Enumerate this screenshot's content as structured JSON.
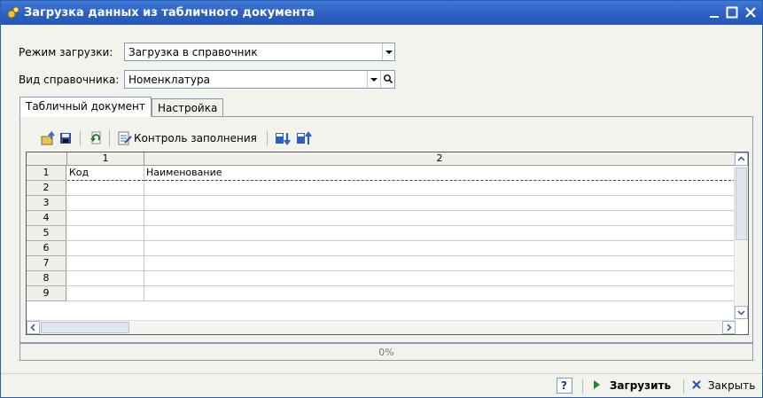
{
  "window": {
    "title": "Загрузка данных из табличного документа",
    "minimize_label": "_",
    "accent": "#2b5fbf"
  },
  "form": {
    "mode_label": "Режим загрузки:",
    "mode_value": "Загрузка в справочник",
    "kind_label": "Вид справочника:",
    "kind_value": "Номенклатура"
  },
  "tabs": [
    {
      "label": "Табличный документ",
      "active": true
    },
    {
      "label": "Настройка",
      "active": false
    }
  ],
  "toolbar": {
    "fill_control_label": "Контроль заполнения"
  },
  "grid": {
    "columns": [
      "1",
      "2"
    ],
    "rows": [
      "1",
      "2",
      "3",
      "4",
      "5",
      "6",
      "7",
      "8",
      "9"
    ],
    "header_cells": [
      "Код",
      "Наименование"
    ]
  },
  "progress": {
    "text": "0%",
    "value": 0
  },
  "bottom": {
    "help_label": "?",
    "load_label": "Загрузить",
    "close_label": "Закрыть"
  }
}
